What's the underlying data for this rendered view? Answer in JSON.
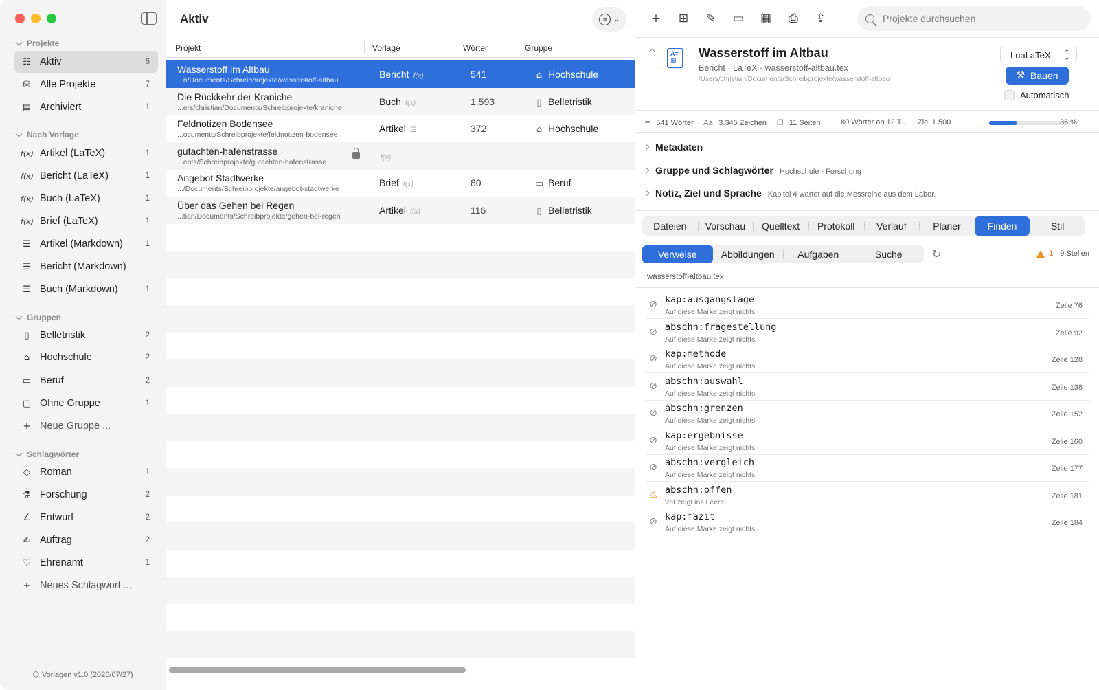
{
  "colors": {
    "accent": "#2f6fdc",
    "close": "#ff5f57",
    "minimize": "#febc2e",
    "zoom": "#28c840",
    "warning": "#f0901f"
  },
  "sidebar": {
    "sections": [
      {
        "title": "Projekte",
        "items": [
          {
            "icon": "project-icon",
            "glyph": "☷",
            "label": "Aktiv",
            "count": "6",
            "selected": true
          },
          {
            "icon": "stack-icon",
            "glyph": "⛁",
            "label": "Alle Projekte",
            "count": "7"
          },
          {
            "icon": "archive-icon",
            "glyph": "▤",
            "label": "Archiviert",
            "count": "1"
          }
        ]
      },
      {
        "title": "Nach Vorlage",
        "items": [
          {
            "icon": "function-icon",
            "glyph": "f(x)",
            "label": "Artikel (LaTeX)",
            "count": "1"
          },
          {
            "icon": "function-icon",
            "glyph": "f(x)",
            "label": "Bericht (LaTeX)",
            "count": "1"
          },
          {
            "icon": "function-icon",
            "glyph": "f(x)",
            "label": "Buch (LaTeX)",
            "count": "1"
          },
          {
            "icon": "function-icon",
            "glyph": "f(x)",
            "label": "Brief (LaTeX)",
            "count": "1"
          },
          {
            "icon": "text-icon",
            "glyph": "☰",
            "label": "Artikel (Markdown)",
            "count": "1"
          },
          {
            "icon": "text-icon",
            "glyph": "☰",
            "label": "Bericht (Markdown)",
            "count": ""
          },
          {
            "icon": "text-icon",
            "glyph": "☰",
            "label": "Buch (Markdown)",
            "count": "1"
          }
        ]
      },
      {
        "title": "Gruppen",
        "items": [
          {
            "icon": "book-icon",
            "glyph": "▯",
            "label": "Belletristik",
            "count": "2"
          },
          {
            "icon": "graduation-cap-icon",
            "glyph": "⌂",
            "label": "Hochschule",
            "count": "2"
          },
          {
            "icon": "briefcase-icon",
            "glyph": "▭",
            "label": "Beruf",
            "count": "2"
          },
          {
            "icon": "folder-badge-icon",
            "glyph": "▢",
            "label": "Ohne Gruppe",
            "count": "1"
          },
          {
            "icon": "plus-icon",
            "glyph": "+",
            "label": "Neue Gruppe ...",
            "count": "",
            "muted": true
          }
        ]
      },
      {
        "title": "Schlagwörter",
        "items": [
          {
            "icon": "tag-icon",
            "glyph": "◇",
            "label": "Roman",
            "count": "1"
          },
          {
            "icon": "flask-icon",
            "glyph": "⚗",
            "label": "Forschung",
            "count": "2"
          },
          {
            "icon": "angle-icon",
            "glyph": "∠",
            "label": "Entwurf",
            "count": "2"
          },
          {
            "icon": "signature-icon",
            "glyph": "✍",
            "label": "Auftrag",
            "count": "2"
          },
          {
            "icon": "heart-icon",
            "glyph": "♡",
            "label": "Ehrenamt",
            "count": "1"
          },
          {
            "icon": "plus-icon",
            "glyph": "+",
            "label": "Neues Schlagwort ...",
            "count": "",
            "muted": true
          }
        ]
      }
    ],
    "footer": "Vorlagen v1.0 (2026/07/27)"
  },
  "list": {
    "title": "Aktiv",
    "columns": [
      "Projekt",
      "Vorlage",
      "Wörter",
      "Gruppe"
    ],
    "rows": [
      {
        "name": "Wasserstoff im Altbau",
        "path": "...n/Documents/Schreibprojekte/wasserstoff-altbau",
        "template": "Bericht",
        "template_glyph": "f(x)",
        "words": "541",
        "group": "Hochschule",
        "group_icon": "graduation-cap-icon",
        "group_glyph": "⌂",
        "selected": true
      },
      {
        "name": "Die Rückkehr der Kraniche",
        "path": "...ers/christian/Documents/Schreibprojekte/kraniche",
        "template": "Buch",
        "template_glyph": "f(x)",
        "words": "1.593",
        "group": "Belletristik",
        "group_icon": "book-icon",
        "group_glyph": "▯"
      },
      {
        "name": "Feldnotizen Bodensee",
        "path": "...ocuments/Schreibprojekte/feldnotizen-bodensee",
        "template": "Artikel",
        "template_glyph": "☰",
        "words": "372",
        "group": "Hochschule",
        "group_icon": "graduation-cap-icon",
        "group_glyph": "⌂"
      },
      {
        "name": "gutachten-hafenstrasse",
        "path": "...ents/Schreibprojekte/gutachten-hafenstrasse",
        "template": "",
        "template_glyph": "f(x)",
        "words": "—",
        "group": "—",
        "group_icon": "",
        "group_glyph": "",
        "locked": true
      },
      {
        "name": "Angebot Stadtwerke",
        "path": ".../Documents/Schreibprojekte/angebot-stadtwerke",
        "template": "Brief",
        "template_glyph": "f(x)",
        "words": "80",
        "group": "Beruf",
        "group_icon": "briefcase-icon",
        "group_glyph": "▭"
      },
      {
        "name": "Über das Gehen bei Regen",
        "path": "...tian/Documents/Schreibprojekte/gehen-bei-regen",
        "template": "Artikel",
        "template_glyph": "f(x)",
        "words": "116",
        "group": "Belletristik",
        "group_icon": "book-icon",
        "group_glyph": "▯"
      }
    ]
  },
  "toolbar": {
    "icons": [
      {
        "name": "plus-icon",
        "glyph": "+"
      },
      {
        "name": "new-folder-icon",
        "glyph": "⊞"
      },
      {
        "name": "compose-icon",
        "glyph": "✎"
      },
      {
        "name": "folder-icon",
        "glyph": "▭"
      },
      {
        "name": "template-icon",
        "glyph": "▦"
      },
      {
        "name": "print-icon",
        "glyph": "⎙"
      },
      {
        "name": "share-icon",
        "glyph": "⇪"
      }
    ],
    "search_placeholder": "Projekte durchsuchen"
  },
  "detail": {
    "title": "Wasserstoff im Altbau",
    "subtitle": "Bericht · LaTeX · wasserstoff-altbau.tex",
    "path": "/Users/christian/Documents/Schreibprojekte/wasserstoff-altbau",
    "engine": "LuaLaTeX",
    "build_label": "Bauen",
    "auto_label": "Automatisch",
    "stats": {
      "words": "541 Wörter",
      "chars": "3.345 Zeichen",
      "pages": "11 Seiten",
      "today": "80 Wörter an 12 T...",
      "goal": "Ziel 1.500",
      "progress_pct": "36 %",
      "progress_fraction": 0.36
    },
    "sections": [
      {
        "label": "Metadaten",
        "sub": ""
      },
      {
        "label": "Gruppe und Schlagwörter",
        "sub": "Hochschule · Forschung"
      },
      {
        "label": "Notiz, Ziel und Sprache",
        "sub": "Kapitel 4 wartet auf die Messreihe aus dem Labor."
      }
    ],
    "tabs": [
      "Dateien",
      "Vorschau",
      "Quelltext",
      "Protokoll",
      "Verlauf",
      "Planer",
      "Finden",
      "Stil"
    ],
    "active_tab": 6,
    "subtabs": [
      "Verweise",
      "Abbildungen",
      "Aufgaben",
      "Suche"
    ],
    "active_subtab": 0,
    "warning_count": "1",
    "places": "9 Stellen",
    "file": "wasserstoff-altbau.tex",
    "references": [
      {
        "label": "kap:ausgangslage",
        "desc": "Auf diese Marke zeigt nichts",
        "line": "Zeile 76"
      },
      {
        "label": "abschn:fragestellung",
        "desc": "Auf diese Marke zeigt nichts",
        "line": "Zeile 92"
      },
      {
        "label": "kap:methode",
        "desc": "Auf diese Marke zeigt nichts",
        "line": "Zeile 128"
      },
      {
        "label": "abschn:auswahl",
        "desc": "Auf diese Marke zeigt nichts",
        "line": "Zeile 138"
      },
      {
        "label": "abschn:grenzen",
        "desc": "Auf diese Marke zeigt nichts",
        "line": "Zeile 152"
      },
      {
        "label": "kap:ergebnisse",
        "desc": "Auf diese Marke zeigt nichts",
        "line": "Zeile 160"
      },
      {
        "label": "abschn:vergleich",
        "desc": "Auf diese Marke zeigt nichts",
        "line": "Zeile 177"
      },
      {
        "label": "abschn:offen",
        "desc": "\\ref zeigt ins Leere",
        "line": "Zeile 181",
        "warning": true
      },
      {
        "label": "kap:fazit",
        "desc": "Auf diese Marke zeigt nichts",
        "line": "Zeile 184"
      }
    ]
  }
}
